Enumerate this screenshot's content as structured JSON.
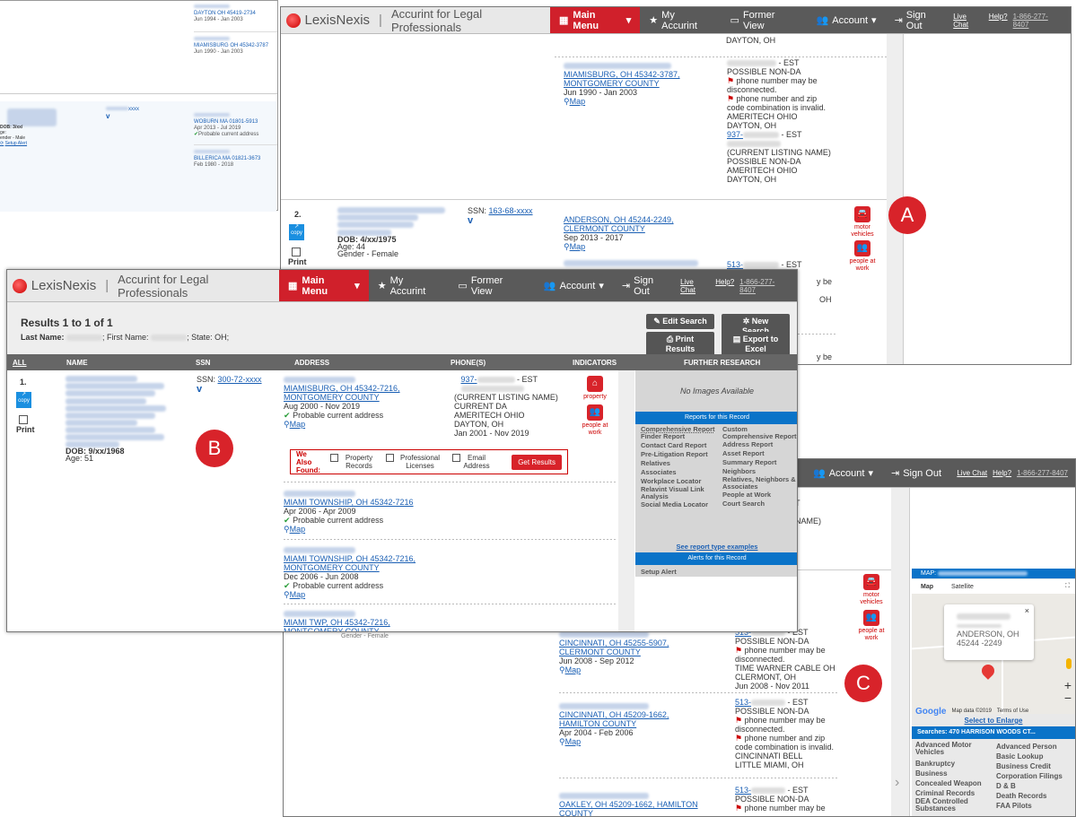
{
  "nav": {
    "brand": "LexisNexis",
    "product": "Accurint for Legal Professionals",
    "main_menu": "Main Menu",
    "my_accurint": "My Accurint",
    "former_view": "Former View",
    "account": "Account",
    "sign_out": "Sign Out",
    "live_chat": "Live Chat",
    "help": "Help?",
    "phone": "1-866-277-8407"
  },
  "bg_left": {
    "addr1": "DAYTON OH 45419-2734",
    "addr1_dates": "Jun 1994 - Jan 2003",
    "addr2": "MIAMISBURG OH 45342-3787",
    "addr2_dates": "Jun 1990 - Jan 2003",
    "ssn": "xxxx",
    "dob": "DOB: 3/xx/",
    "age": "ge:",
    "gender": "ender - Male",
    "setup_alert": "Setup Alert",
    "addr3": "WOBURN MA 01801-5913",
    "addr3_dates": "Apr 2013 - Jul 2019",
    "addr3_note": "Probable current address",
    "addr4": "BILLERICA MA 01821-3673",
    "addr4_dates": "Feb 1980 - 2018"
  },
  "win_a": {
    "top_city": "DAYTON, OH",
    "r1_addr": "MIAMISBURG, OH 45342-3787, MONTGOMERY COUNTY",
    "r1_dates": "Jun 1990 - Jan 2003",
    "map": "Map",
    "ph1_type": "- EST",
    "ph1_l1": "POSSIBLE NON-DA",
    "ph1_l2": "phone number may be disconnected.",
    "ph1_l3": "phone number and zip code combination is invalid.",
    "ph1_l4": "AMERITECH OHIO",
    "ph1_l5": "DAYTON, OH",
    "ph2_prefix": "937-",
    "ph2_type": "- EST",
    "ph2_l1": "(CURRENT LISTING NAME)",
    "ph2_l2": "POSSIBLE NON-DA",
    "ph2_l3": "AMERITECH OHIO",
    "ph2_l4": "DAYTON, OH",
    "rec_num": "2.",
    "copy": "copy",
    "print": "Print",
    "dob": "DOB: 4/xx/1975",
    "age": "Age: 44",
    "gender": "Gender - Female",
    "ssn_label": "SSN:",
    "ssn": "163-68-xxxx",
    "r2_addr": "ANDERSON, OH 45244-2249, CLERMONT COUNTY",
    "r2_dates": "Sep 2013 - 2017",
    "ph3_prefix": "513-",
    "ph3_type": "- EST",
    "motor": "motor vehicles",
    "people": "people at work",
    "trail1": "y be",
    "trail2": "OH",
    "trail3": "y be"
  },
  "win_b": {
    "results": "Results 1 to 1 of 1",
    "last_name": "Last Name:",
    "first_name": "; First Name:",
    "state": "; State:",
    "state_val": "OH;",
    "edit": "Edit Search",
    "new": "New Search",
    "printres": "Print Results",
    "export": "Export to Excel",
    "cols": [
      "ALL",
      "NAME",
      "SSN",
      "ADDRESS",
      "PHONE(S)",
      "INDICATORS",
      "FURTHER RESEARCH"
    ],
    "rec_num": "1.",
    "copy": "copy",
    "print": "Print",
    "dob": "DOB: 9/xx/1968",
    "age": "Age: 51",
    "ssn_label": "SSN:",
    "ssn": "300-72-xxxx",
    "a1": "MIAMISBURG, OH 45342-7216, MONTGOMERY COUNTY",
    "a1_dates": "Aug 2000 - Nov 2019",
    "probable": "Probable current address",
    "map": "Map",
    "p_prefix": "937-",
    "p_type": "- EST",
    "p_l1": "(CURRENT LISTING NAME)",
    "p_l2": "CURRENT DA",
    "p_l3": "AMERITECH OHIO",
    "p_l4": "DAYTON, OH",
    "p_l5": "Jan 2001 - Nov 2019",
    "also": "We Also Found:",
    "prop": "Property Records",
    "prof": "Professional Licenses",
    "email": "Email Address",
    "get": "Get Results",
    "a2": "MIAMI TOWNSHIP, OH 45342-7216",
    "a2_dates": "Apr 2006 - Apr 2009",
    "a3": "MIAMI TOWNSHIP, OH 45342-7216, MONTGOMERY COUNTY",
    "a3_dates": "Dec 2006 - Jun 2008",
    "a4": "MIAMI TWP, OH 45342-7216, MONTGOMERY COUNTY",
    "property": "property",
    "people": "people at work",
    "no_images": "No Images Available",
    "reports_hdr": "Reports for this Record",
    "reports_l": [
      "Comprehensive Report",
      "Finder Report",
      "Contact Card Report",
      "Pre-Litigation Report",
      "Relatives",
      "Associates",
      "Workplace Locator",
      "Relavint Visual Link Analysis",
      "Social Media Locator"
    ],
    "reports_r": [
      "Custom Comprehensive Report",
      "Address Report",
      "Asset Report",
      "Summary Report",
      "Neighbors",
      "Relatives, Neighbors & Associates",
      "People at Work",
      "Court Search"
    ],
    "examples": "See report type examples",
    "alerts_hdr": "Alerts for this Record",
    "setup_alert": "Setup Alert",
    "gender_under": "Gender - Female"
  },
  "win_c": {
    "map_label": "MAP:",
    "map_tab": "Map",
    "sat_tab": "Satellite",
    "pop_city": "ANDERSON, OH",
    "pop_zip": "45244 -2249",
    "google": "Google",
    "mapdata": "Map data ©2019",
    "terms": "Terms of Use",
    "enlarge": "Select to Enlarge",
    "searches": "Searches: 470 HARRISON WOODS CT...",
    "list_l": [
      "Advanced Motor Vehicles",
      "Bankruptcy",
      "Business",
      "Concealed Weapon",
      "Criminal Records",
      "DEA Controlled Substances"
    ],
    "list_r": [
      "Advanced Person",
      "Basic Lookup",
      "Business Credit",
      "Corporation Filings",
      "D & B",
      "Death Records",
      "FAA Pilots"
    ],
    "motor": "motor vehicles",
    "people": "people at work",
    "t1": "T",
    "t2": "NAME)",
    "c1": "CINCINNATI, OH 45255-5907, CLERMONT COUNTY",
    "c1_dates": "Jun 2008 - Sep 2012",
    "c1_p": "513-",
    "c1_type": "- EST",
    "c1_l1": "POSSIBLE NON-DA",
    "c1_l2": "phone number may be disconnected.",
    "c1_l3": "TIME WARNER CABLE OH",
    "c1_l4": "CLERMONT, OH",
    "c1_l5": "Jun 2008 - Nov 2011",
    "c2": "CINCINNATI, OH 45209-1662, HAMILTON COUNTY",
    "c2_dates": "Apr 2004 - Feb 2006",
    "c2_p": "513-",
    "c2_type": "- EST",
    "c2_l1": "POSSIBLE NON-DA",
    "c2_l2": "phone number may be disconnected.",
    "c2_l3": "phone number and zip code combination is invalid.",
    "c2_l4": "CINCINNATI BELL",
    "c2_l5": "LITTLE MIAMI, OH",
    "c3": "OAKLEY, OH 45209-1662, HAMILTON COUNTY",
    "c3_p": "513-",
    "c3_type": "- EST",
    "c3_l1": "POSSIBLE NON-DA",
    "c3_l2": "phone number may be",
    "map": "Map"
  },
  "badges": {
    "a": "A",
    "b": "B",
    "c": "C"
  },
  "colors": {
    "brand_red": "#d0202b",
    "nav_dark": "#5a5a5a",
    "link": "#1a5fb4",
    "blue_bar": "#0a73c8"
  }
}
